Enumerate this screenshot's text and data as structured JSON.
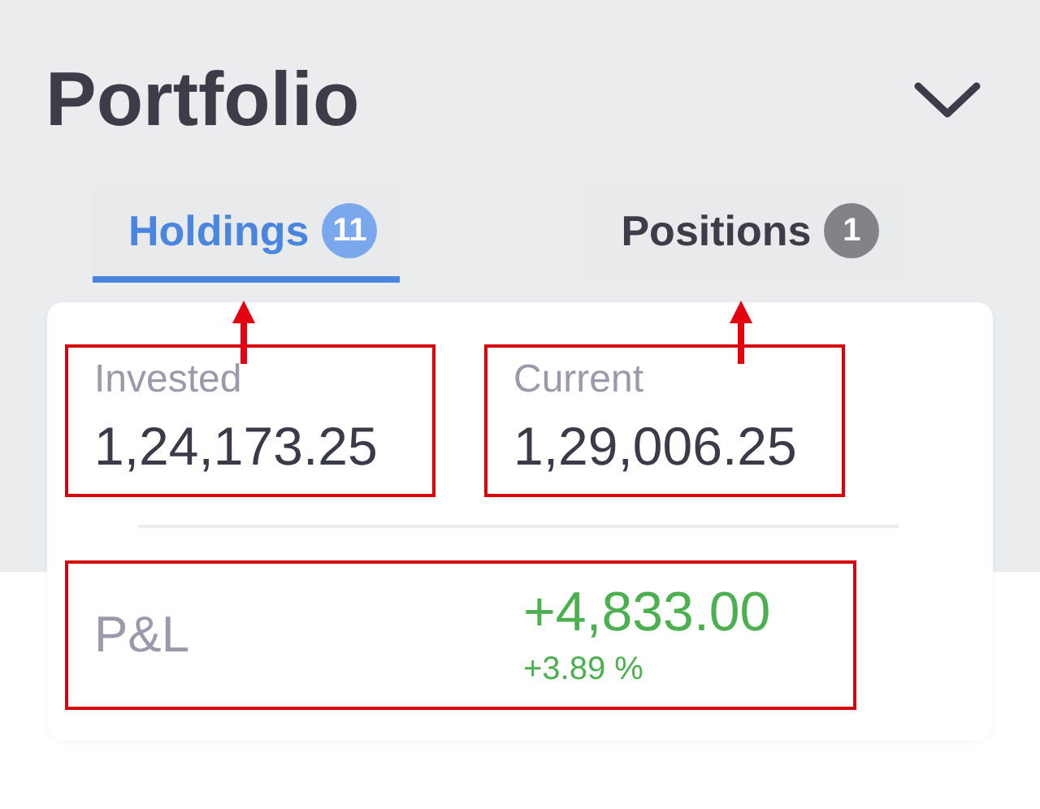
{
  "header": {
    "title": "Portfolio"
  },
  "tabs": [
    {
      "label": "Holdings",
      "count": "11",
      "selected": true,
      "marked": true
    },
    {
      "label": "Positions",
      "count": "1",
      "selected": false,
      "marked": true
    }
  ],
  "summary": {
    "stats": [
      {
        "label": "Invested",
        "value": "1,24,173.25",
        "highlighted": true
      },
      {
        "label": "Current",
        "value": "1,29,006.25",
        "highlighted": true
      }
    ],
    "pnl": {
      "label": "P&L",
      "value": "+4,833.00",
      "percent": "+3.89 %",
      "positive": true,
      "highlighted": true
    }
  }
}
